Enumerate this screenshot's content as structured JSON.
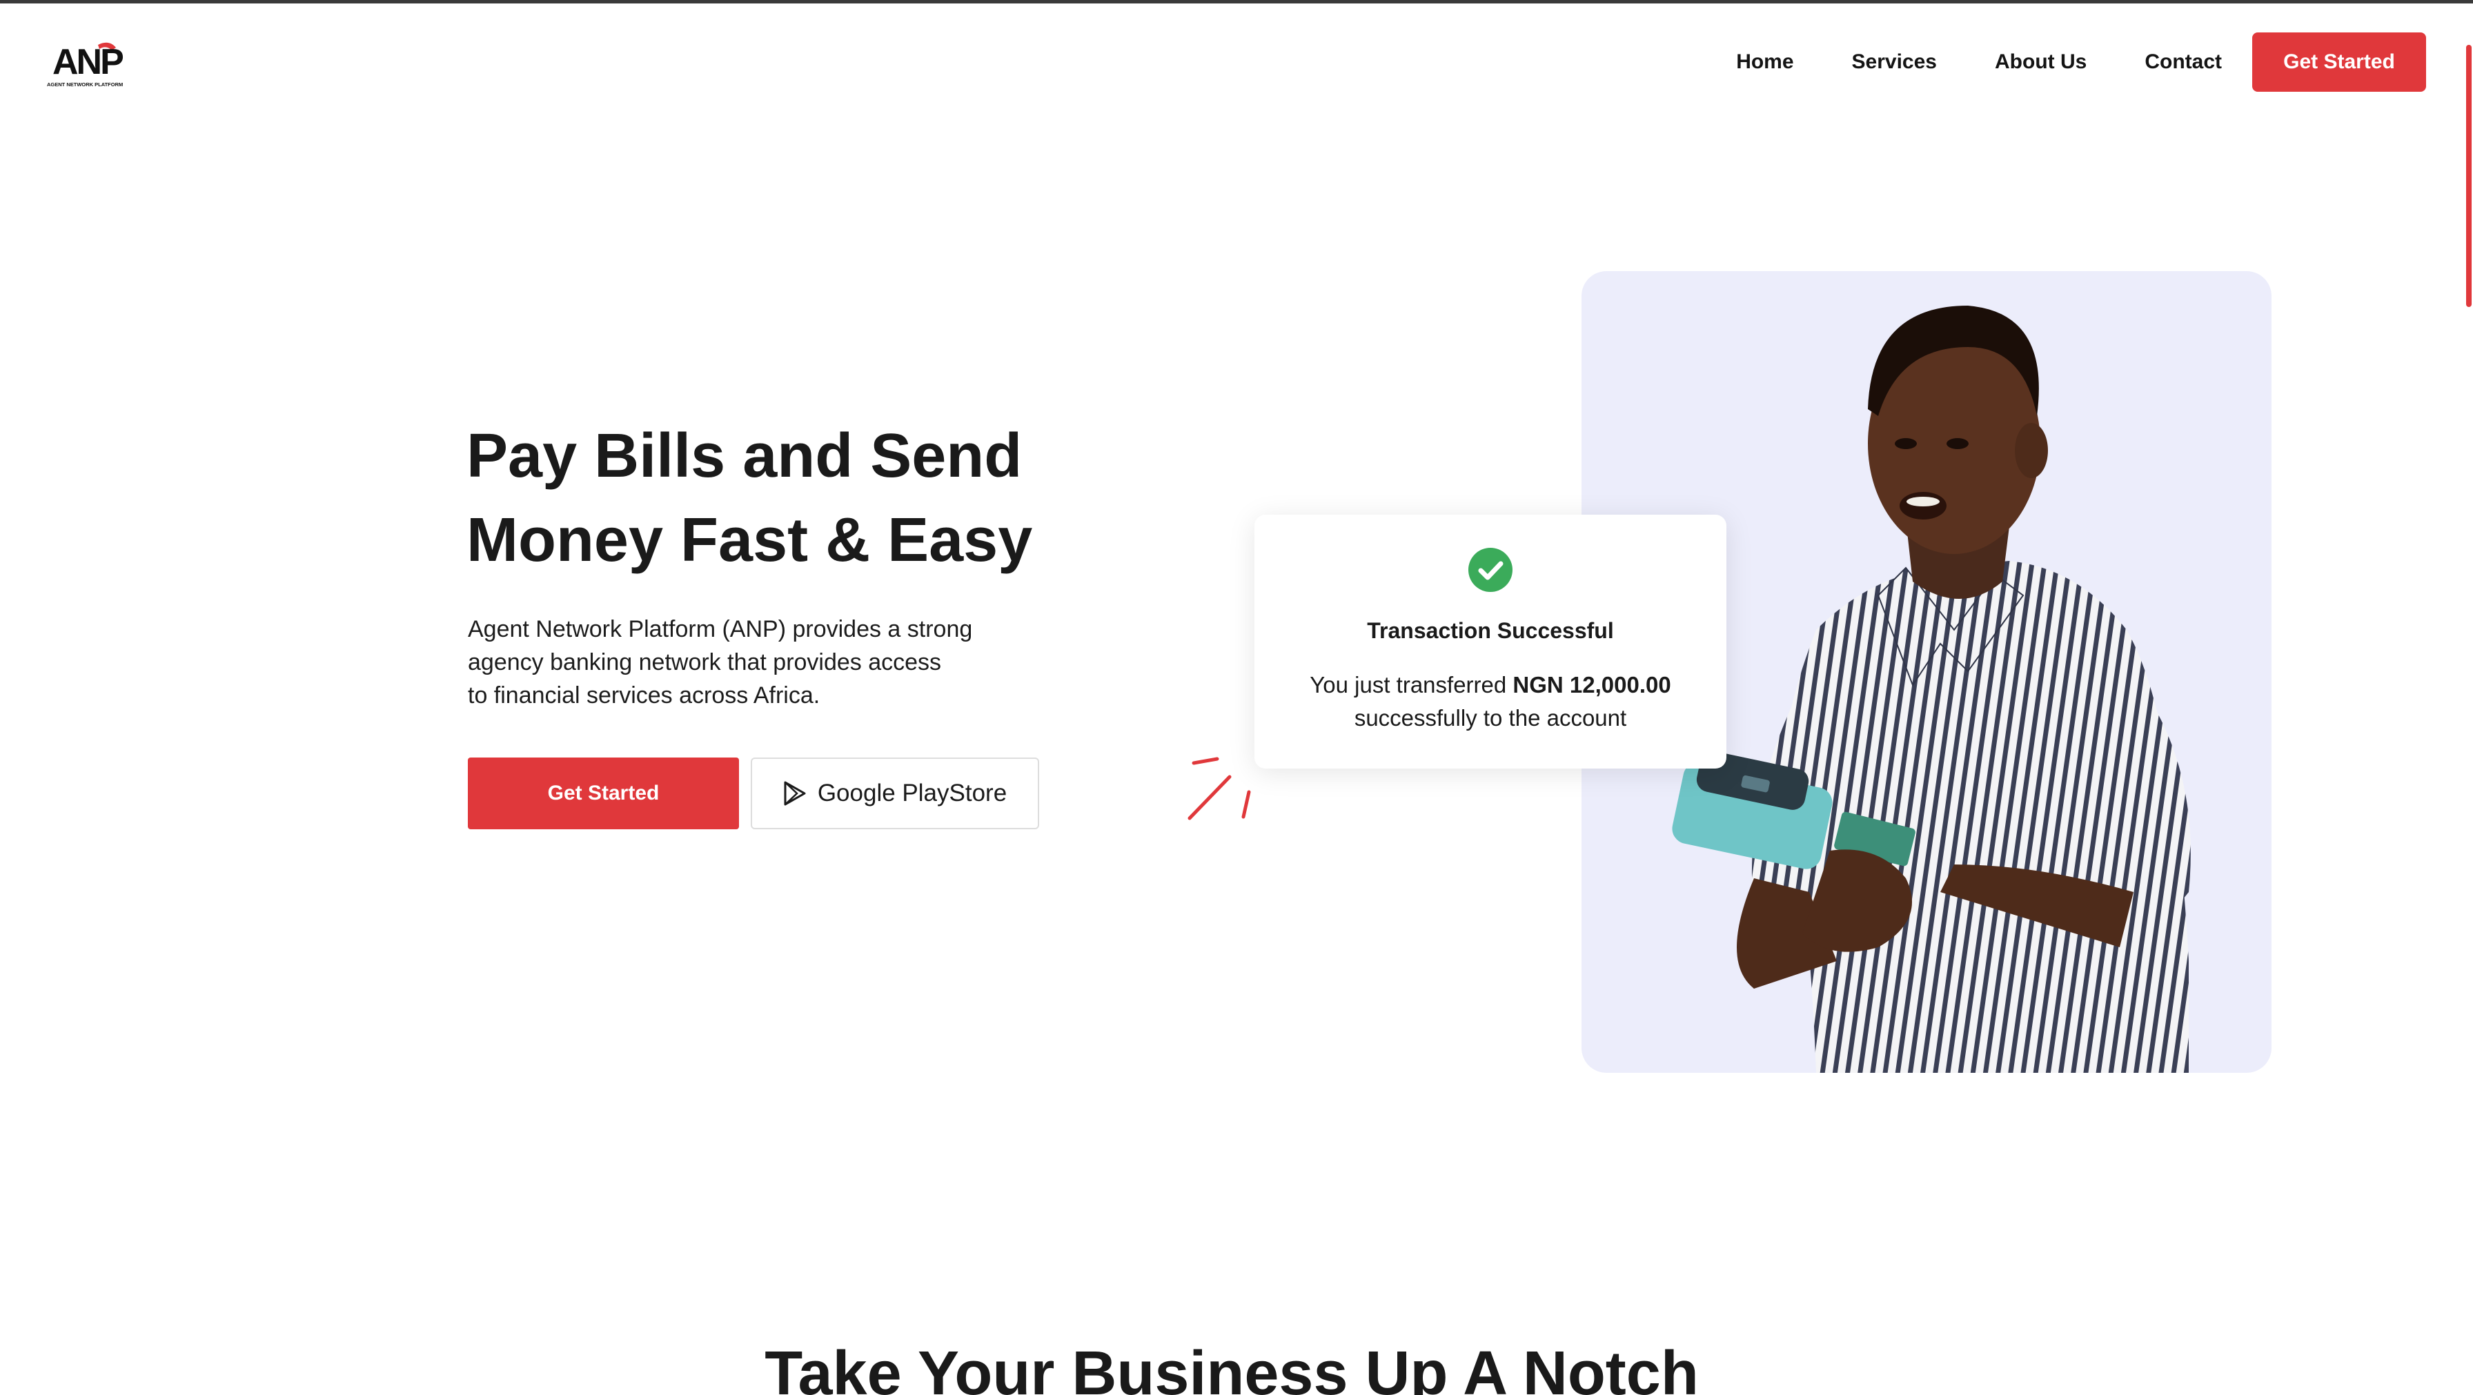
{
  "header": {
    "logo_text": "ANP",
    "logo_subtitle": "AGENT NETWORK PLATFORM",
    "nav": [
      {
        "label": "Home"
      },
      {
        "label": "Services"
      },
      {
        "label": "About Us"
      },
      {
        "label": "Contact"
      }
    ],
    "cta_label": "Get Started"
  },
  "hero": {
    "title_line1": "Pay Bills and Send",
    "title_line2": "Money Fast & Easy",
    "desc_line1": "Agent Network Platform (ANP) provides a strong",
    "desc_line2": "agency banking network that provides access",
    "desc_line3": "to financial services across Africa.",
    "primary_button": "Get Started",
    "store_button": "Google PlayStore",
    "store_icon": "play-store-icon"
  },
  "transaction_card": {
    "title": "Transaction Successful",
    "line1_prefix": "You just transferred ",
    "amount": "NGN 12,000.00",
    "line2": "successfully to the account",
    "icon": "check-circle-icon"
  },
  "section": {
    "title": "Take Your Business Up A Notch"
  },
  "colors": {
    "accent": "#e0383b",
    "success": "#3bab5a",
    "panel": "#ecedfb"
  }
}
